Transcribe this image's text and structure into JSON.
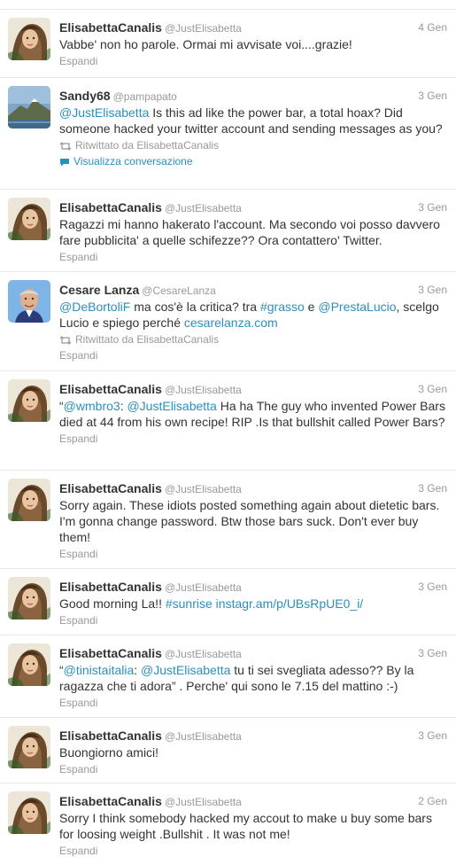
{
  "colors": {
    "link": "#2a8fbd",
    "muted": "#999999",
    "text": "#333333",
    "border": "#e8e8e8"
  },
  "tweets": [
    {
      "avatar": "elisabetta",
      "name": "ElisabettaCanalis",
      "handle": "@JustElisabetta",
      "time": "4 Gen",
      "segments": [
        {
          "text": "Vabbe' non ho parole. Ormai mi avvisate voi....grazie!",
          "link": false
        }
      ],
      "retweeted_by": null,
      "conversation": null,
      "expand": "Espandi"
    },
    {
      "avatar": "sandy",
      "name": "Sandy68",
      "handle": "@pampapato",
      "time": "3 Gen",
      "segments": [
        {
          "text": "@JustElisabetta",
          "link": true
        },
        {
          "text": " Is this ad like the power bar, a total hoax? Did someone hacked your twitter account and sending messages as you?",
          "link": false
        }
      ],
      "retweeted_by": "Ritwittato da ElisabettaCanalis",
      "conversation": "Visualizza conversazione",
      "expand": null
    },
    {
      "avatar": "elisabetta",
      "name": "ElisabettaCanalis",
      "handle": "@JustElisabetta",
      "time": "3 Gen",
      "segments": [
        {
          "text": "Ragazzi mi hanno hakerato l'account. Ma secondo voi posso davvero fare pubblicita' a quelle schifezze?? Ora contattero' Twitter.",
          "link": false
        }
      ],
      "retweeted_by": null,
      "conversation": null,
      "expand": "Espandi"
    },
    {
      "avatar": "cesare",
      "name": "Cesare Lanza",
      "handle": "@CesareLanza",
      "time": "3 Gen",
      "segments": [
        {
          "text": "@DeBortoliF",
          "link": true
        },
        {
          "text": " ma cos'è la critica? tra ",
          "link": false
        },
        {
          "text": "#grasso",
          "link": true
        },
        {
          "text": " e ",
          "link": false
        },
        {
          "text": "@PrestaLucio",
          "link": true
        },
        {
          "text": ", scelgo Lucio e spiego perché ",
          "link": false
        },
        {
          "text": "cesarelanza.com",
          "link": true
        }
      ],
      "retweeted_by": "Ritwittato da ElisabettaCanalis",
      "conversation": null,
      "expand": "Espandi"
    },
    {
      "avatar": "elisabetta",
      "name": "ElisabettaCanalis",
      "handle": "@JustElisabetta",
      "time": "3 Gen",
      "segments": [
        {
          "text": "“",
          "link": false
        },
        {
          "text": "@wmbro3",
          "link": true
        },
        {
          "text": ": ",
          "link": false
        },
        {
          "text": "@JustElisabetta",
          "link": true
        },
        {
          "text": " Ha ha The guy who invented Power Bars died at 44 from his own recipe! RIP .Is that bullshit called Power Bars?",
          "link": false
        }
      ],
      "retweeted_by": null,
      "conversation": null,
      "expand": "Espandi"
    },
    {
      "avatar": "elisabetta",
      "name": "ElisabettaCanalis",
      "handle": "@JustElisabetta",
      "time": "3 Gen",
      "segments": [
        {
          "text": "Sorry again. These idiots posted something again about dietetic bars. I'm gonna change password. Btw those bars suck. Don't ever buy them!",
          "link": false
        }
      ],
      "retweeted_by": null,
      "conversation": null,
      "expand": "Espandi"
    },
    {
      "avatar": "elisabetta",
      "name": "ElisabettaCanalis",
      "handle": "@JustElisabetta",
      "time": "3 Gen",
      "segments": [
        {
          "text": "Good morning La!! ",
          "link": false
        },
        {
          "text": "#sunrise",
          "link": true
        },
        {
          "text": " ",
          "link": false
        },
        {
          "text": "instagr.am/p/UBsRpUE0_i/",
          "link": true
        }
      ],
      "retweeted_by": null,
      "conversation": null,
      "expand": "Espandi"
    },
    {
      "avatar": "elisabetta",
      "name": "ElisabettaCanalis",
      "handle": "@JustElisabetta",
      "time": "3 Gen",
      "segments": [
        {
          "text": "“",
          "link": false
        },
        {
          "text": "@tinistaitalia",
          "link": true
        },
        {
          "text": ": ",
          "link": false
        },
        {
          "text": "@JustElisabetta",
          "link": true
        },
        {
          "text": " tu ti sei svegliata adesso?? By la ragazza che ti adora” . Perche' qui sono le 7.15 del mattino :-)",
          "link": false
        }
      ],
      "retweeted_by": null,
      "conversation": null,
      "expand": "Espandi"
    },
    {
      "avatar": "elisabetta",
      "name": "ElisabettaCanalis",
      "handle": "@JustElisabetta",
      "time": "3 Gen",
      "segments": [
        {
          "text": "Buongiorno amici!",
          "link": false
        }
      ],
      "retweeted_by": null,
      "conversation": null,
      "expand": "Espandi"
    },
    {
      "avatar": "elisabetta",
      "name": "ElisabettaCanalis",
      "handle": "@JustElisabetta",
      "time": "2 Gen",
      "segments": [
        {
          "text": "Sorry I think somebody hacked my accout to make u buy some bars for loosing weight .Bullshit . It was not me!",
          "link": false
        }
      ],
      "retweeted_by": null,
      "conversation": null,
      "expand": "Espandi"
    }
  ]
}
